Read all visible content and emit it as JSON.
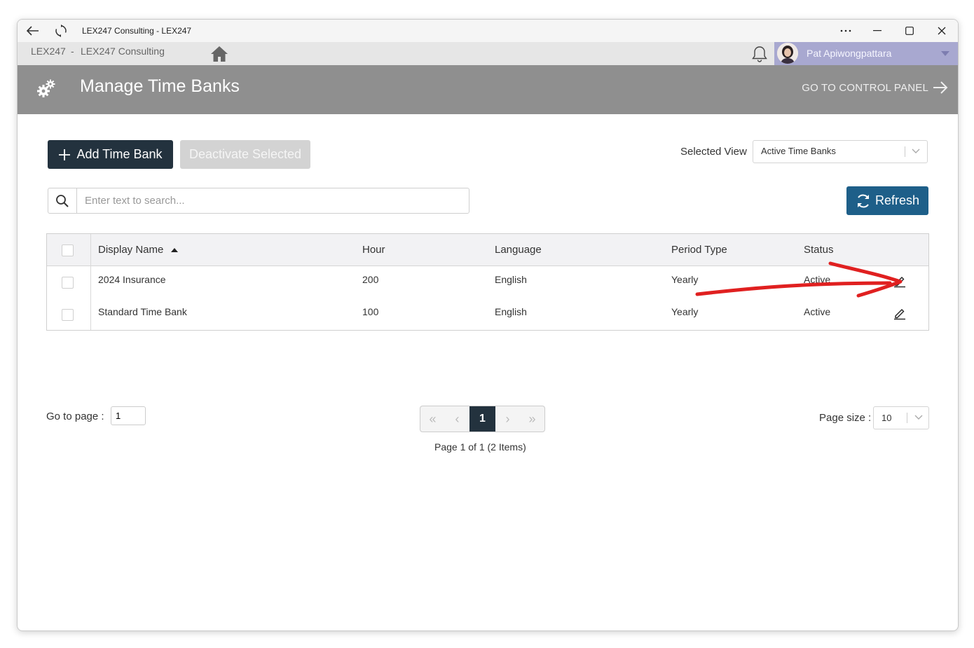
{
  "window": {
    "title": "LEX247 Consulting - LEX247"
  },
  "navbar": {
    "crumb_company": "LEX247",
    "crumb_separator": "-",
    "crumb_office": "LEX247 Consulting",
    "user_name": "Pat Apiwongpattara"
  },
  "header": {
    "title": "Manage Time Banks",
    "control_panel_link": "GO TO CONTROL PANEL"
  },
  "toolbar": {
    "add_label": "Add Time Bank",
    "deactivate_label": "Deactivate Selected",
    "selected_view_label": "Selected View",
    "selected_view_value": "Active Time Banks",
    "refresh_label": "Refresh"
  },
  "search": {
    "placeholder": "Enter text to search..."
  },
  "table": {
    "columns": [
      "Display Name",
      "Hour",
      "Language",
      "Period Type",
      "Status"
    ],
    "rows": [
      [
        "2024 Insurance",
        "200",
        "English",
        "Yearly",
        "Active"
      ],
      [
        "Standard Time Bank",
        "100",
        "English",
        "Yearly",
        "Active"
      ]
    ]
  },
  "pagination": {
    "goto_label": "Go to page :",
    "goto_value": "1",
    "current_page": "1",
    "info": "Page 1 of 1 (2 Items)",
    "page_size_label": "Page size :",
    "page_size_value": "10"
  },
  "colors": {
    "header_bg": "#8f8f8f",
    "primary_dark": "#23323e",
    "refresh_blue": "#1e5f89",
    "user_bg": "#a8a8d0",
    "annotation_red": "#e02020"
  },
  "icons": [
    "back-arrow-icon",
    "refresh-cycle-icon",
    "more-icon",
    "minimize-icon",
    "maximize-icon",
    "close-icon",
    "home-icon",
    "bell-icon",
    "gears-icon",
    "arrow-right-icon",
    "plus-icon",
    "search-icon",
    "sync-icon",
    "sort-asc-icon",
    "pencil-icon",
    "chevron-down-icon"
  ]
}
